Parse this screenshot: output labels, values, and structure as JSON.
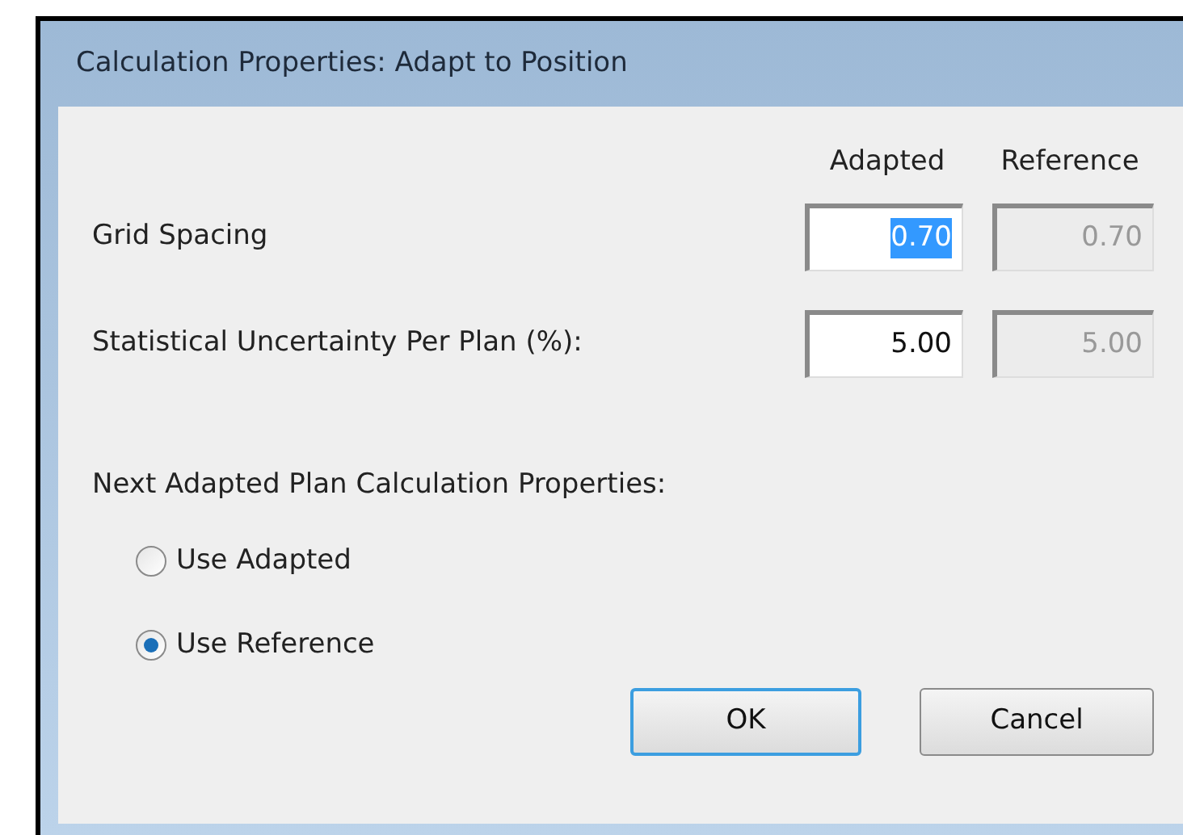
{
  "window": {
    "title": "Calculation Properties: Adapt to Position"
  },
  "columns": [
    "Adapted",
    "Reference"
  ],
  "rows": [
    {
      "label": "Grid Spacing",
      "fields": [
        {
          "value": "0.70",
          "disabled": false,
          "text_selected": true
        },
        {
          "value": "0.70",
          "disabled": true,
          "text_selected": false
        }
      ]
    },
    {
      "label": "Statistical Uncertainty Per Plan (%):",
      "fields": [
        {
          "value": "5.00",
          "disabled": false,
          "text_selected": false
        },
        {
          "value": "5.00",
          "disabled": true,
          "text_selected": false
        }
      ]
    }
  ],
  "next_plan": {
    "label": "Next Adapted Plan Calculation Properties:",
    "options": [
      {
        "label": "Use Adapted",
        "selected": false
      },
      {
        "label": "Use Reference",
        "selected": true
      }
    ]
  },
  "buttons": [
    {
      "label": "OK",
      "default": true
    },
    {
      "label": "Cancel",
      "default": false
    }
  ]
}
